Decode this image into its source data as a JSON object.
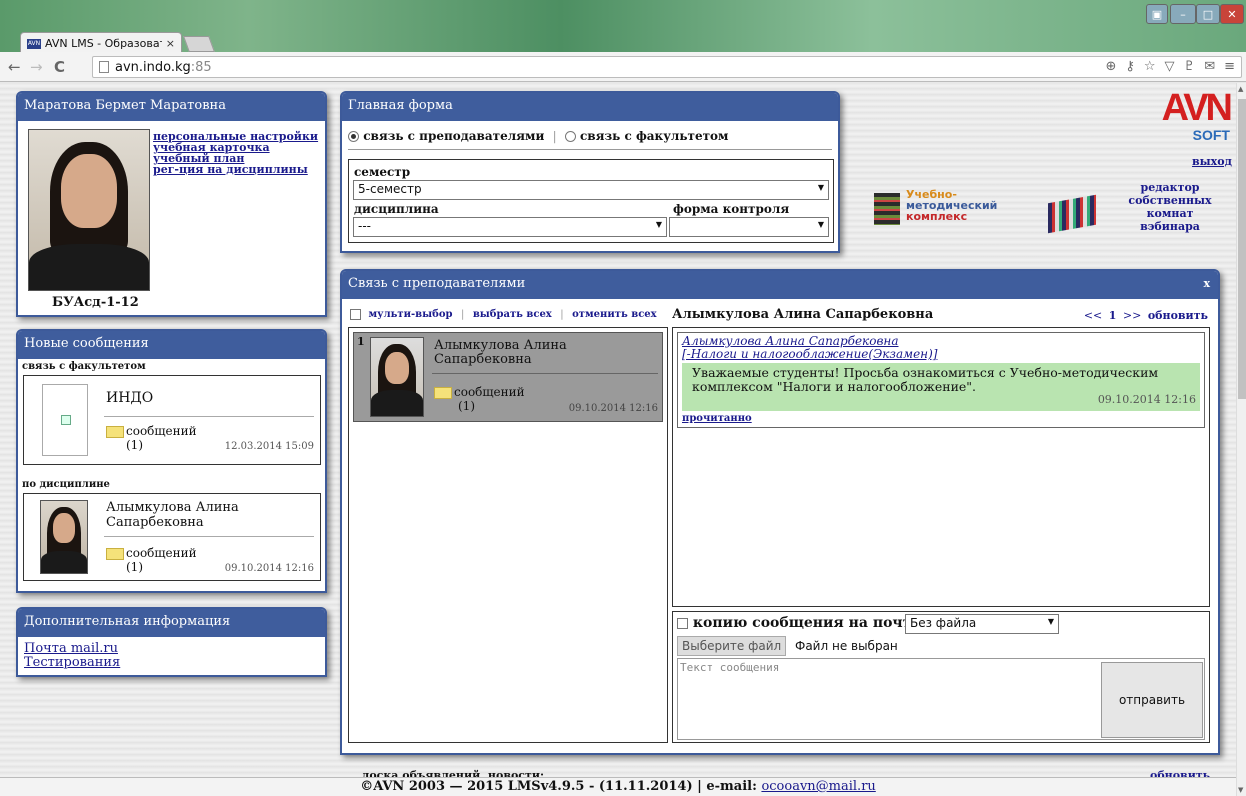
{
  "browser": {
    "tab_title": "AVN LMS - Образователь",
    "tab_close": "×",
    "favicon_text": "AVN",
    "url_host": "avn.indo.kg",
    "url_port": ":85"
  },
  "profile": {
    "title": "Маратова Бермет Маратовна",
    "links": [
      "персональные настройки",
      "учебная карточка",
      "учебный план",
      "рег-ция на дисциплины"
    ],
    "group": "БУАсд-1-12"
  },
  "new_messages": {
    "title": "Новые сообщения",
    "faculty_label": "связь с факультетом",
    "faculty_card": {
      "name": "ИНДО",
      "messages_label": "сообщений",
      "count": "(1)",
      "date": "12.03.2014 15:09"
    },
    "discipline_label": "по дисциплине",
    "discipline_card": {
      "name_line1": "Алымкулова Алина",
      "name_line2": "Сапарбековна",
      "messages_label": "сообщений",
      "count": "(1)",
      "date": "09.10.2014 12:16"
    }
  },
  "extra_info": {
    "title": "Дополнительная информация",
    "links": [
      "Почта mail.ru",
      "Тестирования"
    ]
  },
  "main_form": {
    "title": "Главная форма",
    "radio_teachers": "связь с преподавателями",
    "separator": "|",
    "radio_faculty": "связь с факультетом",
    "semester_label": "семестр",
    "semester_value": "5-семестр",
    "discipline_label": "дисциплина",
    "discipline_value": "---",
    "control_label": "форма контроля",
    "control_value": ""
  },
  "header_right": {
    "logo_main": "AVN",
    "logo_sub": "SOFT",
    "logout": "выход",
    "editor_link": [
      "редактор",
      "собственных",
      "комнат",
      "вэбинара"
    ],
    "umk_text": [
      "Учебно-",
      "методический",
      "комплекс"
    ]
  },
  "teachers_panel": {
    "title": "Связь с преподавателями",
    "close": "x",
    "multi_select": "мульти-выбор",
    "select_all": "выбрать всех",
    "deselect_all": "отменить всех",
    "sep": "|",
    "teacher": {
      "index": "1",
      "name_line1": "Алымкулова Алина",
      "name_line2": "Сапарбековна",
      "messages_label": "сообщений",
      "count": "(1)",
      "date": "09.10.2014 12:16"
    },
    "conversation_title": "Алымкулова Алина Сапарбековна",
    "pager_prev": "<<",
    "pager_page": "1",
    "pager_next": ">>",
    "refresh": "обновить",
    "message": {
      "author": "Алымкулова Алина Сапарбековна",
      "subject": "[-Налоги и налогооблажение(Экзамен)]",
      "text": "Уважаемые студенты! Просьба ознакомиться с Учебно-методическим комплексом \"Налоги и налогообложение\".",
      "date": "09.10.2014 12:16",
      "read_status": "прочитанно"
    },
    "copy_to_mail": "копию сообщения на почту",
    "file_select_value": "Без файла",
    "choose_file_btn": "Выберите файл",
    "no_file": "Файл не выбран",
    "message_placeholder": "Текст сообщения",
    "send_btn": "отправить"
  },
  "footer": {
    "board_text": "доска объявлений, новости:",
    "refresh": "обновить",
    "copyright": "©AVN 2003 — 2015 LMSv4.9.5 - (11.11.2014) | e-mail:",
    "email": "ocooavn@mail.ru"
  }
}
